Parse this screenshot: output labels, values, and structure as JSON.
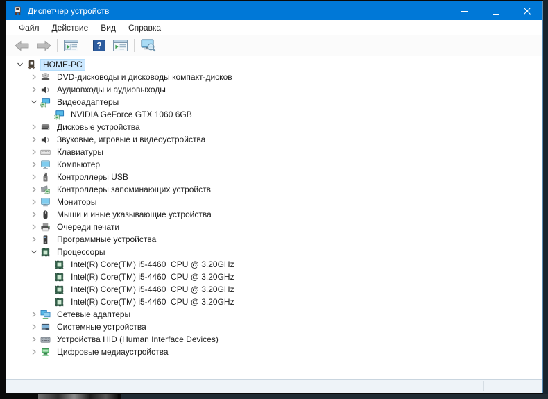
{
  "window": {
    "title": "Диспетчер устройств",
    "control_icons": [
      "minimize-icon",
      "maximize-icon",
      "close-icon"
    ],
    "app_icon": "device-manager-icon"
  },
  "colors": {
    "titlebar_accent": "#0078d7",
    "selection_highlight": "#cce8ff",
    "window_border": "#5a8cb5"
  },
  "menu": {
    "items": [
      "Файл",
      "Действие",
      "Вид",
      "Справка"
    ]
  },
  "toolbar": {
    "icons": [
      "back-icon",
      "forward-icon",
      "show-console-tree-icon",
      "help-icon",
      "properties-icon",
      "scan-hardware-changes-icon"
    ]
  },
  "tree": {
    "items": [
      {
        "label": "HOME-PC",
        "level": 0,
        "state": "expanded",
        "icon": "computer",
        "selected": true
      },
      {
        "label": "DVD-дисководы и дисководы компакт-дисков",
        "level": 1,
        "state": "collapsed",
        "icon": "dvd-drive"
      },
      {
        "label": "Аудиовходы и аудиовыходы",
        "level": 1,
        "state": "collapsed",
        "icon": "audio-device"
      },
      {
        "label": "Видеоадаптеры",
        "level": 1,
        "state": "expanded",
        "icon": "display-adapter"
      },
      {
        "label": "NVIDIA GeForce GTX 1060 6GB",
        "level": 2,
        "state": "leaf",
        "icon": "display-adapter"
      },
      {
        "label": "Дисковые устройства",
        "level": 1,
        "state": "collapsed",
        "icon": "disk-drive"
      },
      {
        "label": "Звуковые, игровые и видеоустройства",
        "level": 1,
        "state": "collapsed",
        "icon": "audio-device"
      },
      {
        "label": "Клавиатуры",
        "level": 1,
        "state": "collapsed",
        "icon": "keyboard"
      },
      {
        "label": "Компьютер",
        "level": 1,
        "state": "collapsed",
        "icon": "monitor"
      },
      {
        "label": "Контроллеры USB",
        "level": 1,
        "state": "collapsed",
        "icon": "usb"
      },
      {
        "label": "Контроллеры запоминающих устройств",
        "level": 1,
        "state": "collapsed",
        "icon": "storage-controller"
      },
      {
        "label": "Мониторы",
        "level": 1,
        "state": "collapsed",
        "icon": "monitor"
      },
      {
        "label": "Мыши и иные указывающие устройства",
        "level": 1,
        "state": "collapsed",
        "icon": "mouse"
      },
      {
        "label": "Очереди печати",
        "level": 1,
        "state": "collapsed",
        "icon": "printer"
      },
      {
        "label": "Программные устройства",
        "level": 1,
        "state": "collapsed",
        "icon": "software-device"
      },
      {
        "label": "Процессоры",
        "level": 1,
        "state": "expanded",
        "icon": "processor"
      },
      {
        "label": "Intel(R) Core(TM) i5-4460  CPU @ 3.20GHz",
        "level": 2,
        "state": "leaf",
        "icon": "processor"
      },
      {
        "label": "Intel(R) Core(TM) i5-4460  CPU @ 3.20GHz",
        "level": 2,
        "state": "leaf",
        "icon": "processor"
      },
      {
        "label": "Intel(R) Core(TM) i5-4460  CPU @ 3.20GHz",
        "level": 2,
        "state": "leaf",
        "icon": "processor"
      },
      {
        "label": "Intel(R) Core(TM) i5-4460  CPU @ 3.20GHz",
        "level": 2,
        "state": "leaf",
        "icon": "processor"
      },
      {
        "label": "Сетевые адаптеры",
        "level": 1,
        "state": "collapsed",
        "icon": "network-adapter"
      },
      {
        "label": "Системные устройства",
        "level": 1,
        "state": "collapsed",
        "icon": "system-device"
      },
      {
        "label": "Устройства HID (Human Interface Devices)",
        "level": 1,
        "state": "collapsed",
        "icon": "hid-device"
      },
      {
        "label": "Цифровые медиаустройства",
        "level": 1,
        "state": "collapsed",
        "icon": "media-device"
      }
    ]
  },
  "status_bar": {
    "text": ""
  }
}
